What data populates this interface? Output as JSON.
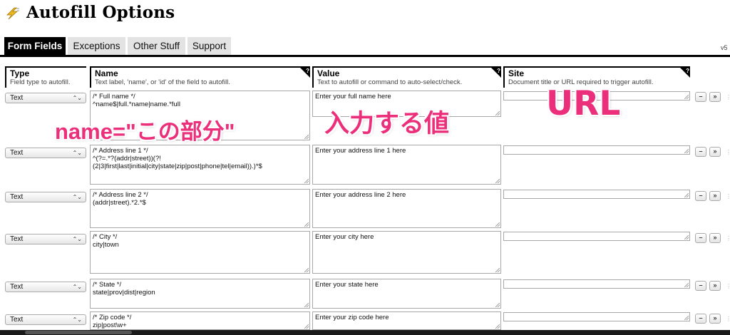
{
  "header": {
    "title": "Autofill Options",
    "logo_icon": "lightning-bolt-icon"
  },
  "tabs": [
    {
      "label": "Form Fields",
      "active": true
    },
    {
      "label": "Exceptions",
      "active": false
    },
    {
      "label": "Other Stuff",
      "active": false
    },
    {
      "label": "Support",
      "active": false
    }
  ],
  "version": "v5",
  "columns": {
    "type": {
      "title": "Type",
      "subtitle": "Field type to autofill."
    },
    "name": {
      "title": "Name",
      "subtitle": "Text label, 'name', or 'id' of the field to autofill."
    },
    "value": {
      "title": "Value",
      "subtitle": "Text to autofill or command to auto-select/check."
    },
    "site": {
      "title": "Site",
      "subtitle": "Document title or URL required to trigger autofill."
    },
    "help_glyph": "?"
  },
  "rows": [
    {
      "type": "Text",
      "name": "/* Full name */\n^name$|full.*name|name.*full",
      "value": "Enter your full name here",
      "site": ""
    },
    {
      "type": "Text",
      "name": "/* Address line 1 */\n^(?=.*?(addr|street))(?!\n(2|3|first|last|initial|city|state|zip|post|phone|tel|email)).)*$",
      "value": "Enter your address line 1 here",
      "site": ""
    },
    {
      "type": "Text",
      "name": "/* Address line 2 */\n(addr|street).*2.*$",
      "value": "Enter your address line 2 here",
      "site": ""
    },
    {
      "type": "Text",
      "name": "/* City */\ncity|town",
      "value": "Enter your city here",
      "site": ""
    },
    {
      "type": "Text",
      "name": "/* State */\nstate|prov|dist|region",
      "value": "Enter your state here",
      "site": ""
    },
    {
      "type": "Text",
      "name": "/* Zip code */\nzip|post\\w+",
      "value": "Enter your zip code here",
      "site": ""
    }
  ],
  "row_buttons": {
    "remove": "–",
    "more": "»"
  },
  "annotations": {
    "name": "name=\"この部分\"",
    "value": "入力する値",
    "url": "URL",
    "color": "#ec2f7b"
  }
}
